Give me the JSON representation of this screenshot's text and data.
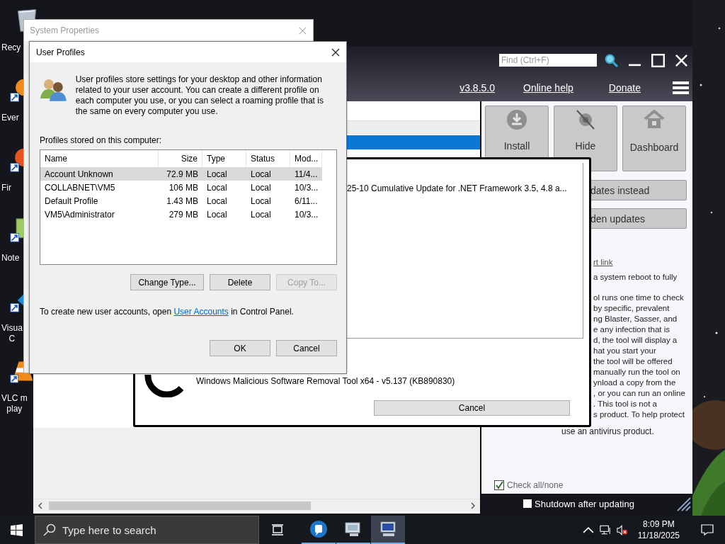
{
  "desktop_icons": [
    {
      "kind": "recycle",
      "lines": [
        "Recy"
      ]
    },
    {
      "kind": "notes",
      "lines": [
        "Ever"
      ]
    },
    {
      "kind": "browser",
      "lines": [
        "Fir"
      ]
    },
    {
      "kind": "editor",
      "lines": [
        "Note"
      ]
    },
    {
      "kind": "code",
      "lines": [
        "Visua",
        "C"
      ]
    },
    {
      "kind": "cone",
      "lines": [
        "VLC m",
        "play"
      ]
    }
  ],
  "updater": {
    "find_placeholder": "Find (Ctrl+F)",
    "links": [
      "v3.8.5.0",
      "Online help",
      "Donate"
    ],
    "actions": [
      {
        "kind": "download",
        "label": "Install"
      },
      {
        "kind": "hide",
        "label": "Hide"
      },
      {
        "kind": "home",
        "label": "Dashboard"
      }
    ],
    "wide_buttons": [
      "dates instead",
      "den updates"
    ],
    "info_link": "rt link",
    "info_lines": [
      "a system reboot to fully",
      "ol runs one time to check",
      "by specific, prevalent",
      "ng Blaster, Sasser, and",
      "e any infection that is",
      "d, the tool will display a",
      "hat you start your",
      "the tool will be offered",
      "manually run the tool on",
      "ynload a copy from the",
      ", or you can run an online",
      ". This tool is not a",
      "s product. To help protect"
    ],
    "info_last": "use an antivirus product.",
    "check_all": {
      "label": "Check all/none",
      "checked": true
    },
    "shutdown": {
      "label": "Shutdown after updating",
      "checked": false
    }
  },
  "progress_dialog": {
    "list_item": "25-10 Cumulative Update for .NET Framework 3.5, 4.8 a...",
    "current": "Windows Malicious Software Removal Tool x64 - v5.137 (KB890830)",
    "cancel": "Cancel"
  },
  "system_properties": {
    "title": "System Properties"
  },
  "user_profiles": {
    "title": "User Profiles",
    "intro": "User profiles store settings for your desktop and other information related to your user account. You can create a different profile on each computer you use, or you can select a roaming profile that is the same on every computer you use.",
    "list_label": "Profiles stored on this computer:",
    "columns": [
      "Name",
      "Size",
      "Type",
      "Status",
      "Mod..."
    ],
    "rows": [
      {
        "cells": [
          "Account Unknown",
          "72.9 MB",
          "Local",
          "Local",
          "11/4..."
        ],
        "selected": true
      },
      {
        "cells": [
          "COLLABNET\\VM5",
          "106 MB",
          "Local",
          "Local",
          "10/3..."
        ],
        "selected": false
      },
      {
        "cells": [
          "Default Profile",
          "1.43 MB",
          "Local",
          "Local",
          "6/11..."
        ],
        "selected": false
      },
      {
        "cells": [
          "VM5\\Administrator",
          "279 MB",
          "Local",
          "Local",
          "10/3..."
        ],
        "selected": false
      }
    ],
    "buttons": [
      {
        "label": "Change Type...",
        "disabled": false
      },
      {
        "label": "Delete",
        "disabled": false
      },
      {
        "label": "Copy To...",
        "disabled": true
      }
    ],
    "footer": {
      "before": "To create new user accounts, open",
      "link": "User Accounts",
      "after": "in Control Panel."
    },
    "dialog_buttons": [
      "OK",
      "Cancel"
    ]
  },
  "taskbar": {
    "search_placeholder": "Type here to search",
    "apps": [
      {
        "kind": "chat",
        "selected": false
      },
      {
        "kind": "monitor",
        "selected": false
      },
      {
        "kind": "computer",
        "selected": true
      }
    ],
    "time": "8:09 PM",
    "date": "11/18/2025"
  }
}
